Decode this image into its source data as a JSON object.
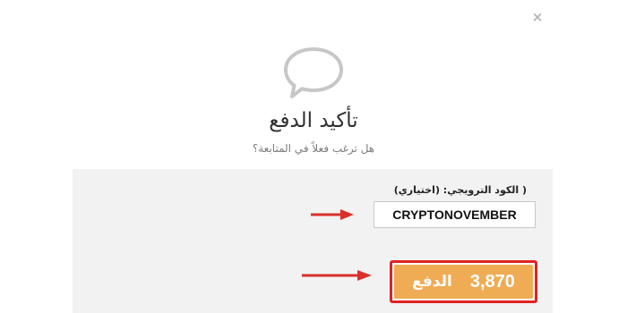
{
  "dialog": {
    "close_glyph": "×",
    "icon": "speech-bubble-icon",
    "title": "تأكيد الدفع",
    "subtitle": "هل ترغب فعلاً في المتابعة؟"
  },
  "coupon": {
    "label": "( الكود الترويجي: (اختياري)",
    "value": "CRYPTONOVEMBER"
  },
  "payment": {
    "amount": "3,870",
    "label": "الدفع"
  },
  "colors": {
    "accent": "#efac54",
    "highlight": "#e02323",
    "panel_bg": "#f2f2f2",
    "icon_gray": "#c7c7c7"
  }
}
